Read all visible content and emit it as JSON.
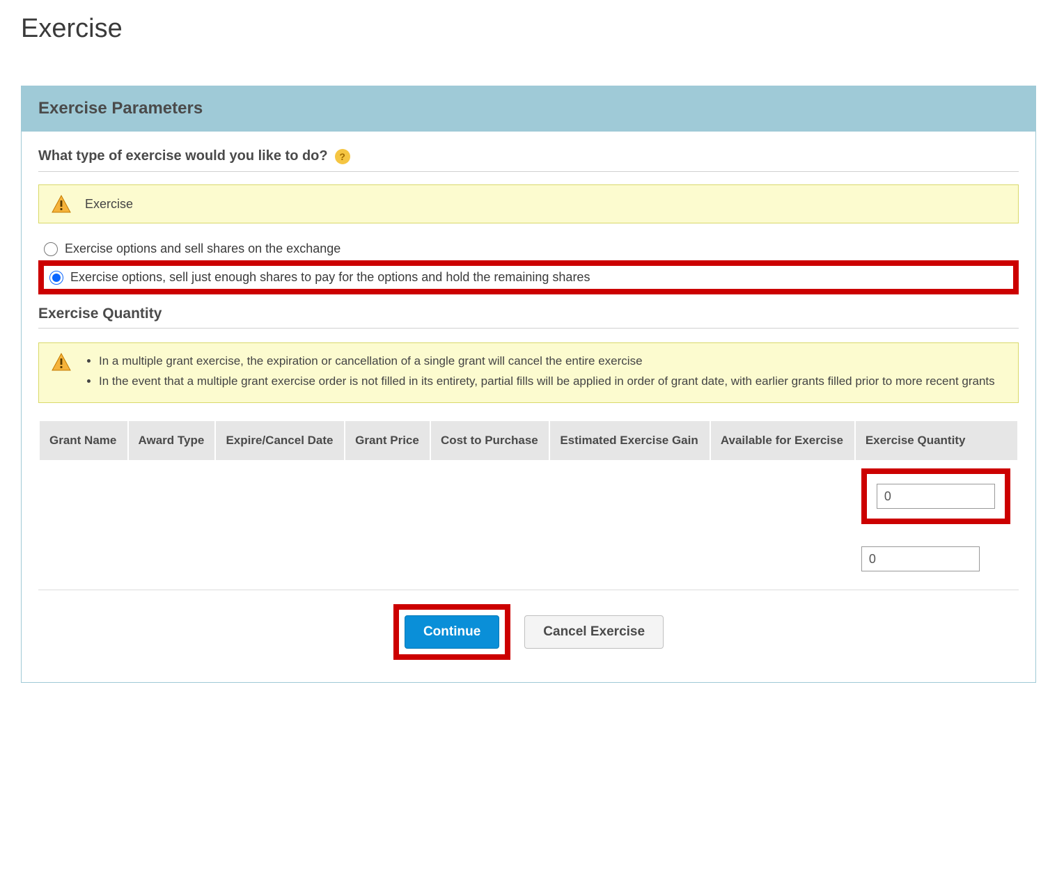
{
  "page_title": "Exercise",
  "panel": {
    "header": "Exercise Parameters",
    "question": "What type of exercise would you like to do?",
    "exercise_alert": "Exercise",
    "radio_options": [
      {
        "label": "Exercise options and sell shares on the exchange",
        "checked": false
      },
      {
        "label": "Exercise options, sell just enough shares to pay for the options and hold the remaining shares",
        "checked": true
      }
    ],
    "quantity_title": "Exercise Quantity",
    "quantity_alert_items": [
      "In a multiple grant exercise, the expiration or cancellation of a single grant will cancel the entire exercise",
      "In the event that a multiple grant exercise order is not filled in its entirety, partial fills will be applied in order of grant date, with earlier grants filled prior to more recent grants"
    ],
    "table": {
      "headers": [
        "Grant Name",
        "Award Type",
        "Expire/Cancel Date",
        "Grant Price",
        "Cost to Purchase",
        "Estimated Exercise Gain",
        "Available for Exercise",
        "Exercise Quantity"
      ],
      "rows": [
        {
          "redacted": true,
          "exercise_quantity": "0",
          "highlighted": true
        },
        {
          "redacted": true,
          "exercise_quantity": "0",
          "highlighted": false
        }
      ]
    },
    "buttons": {
      "continue": "Continue",
      "cancel": "Cancel Exercise"
    }
  }
}
